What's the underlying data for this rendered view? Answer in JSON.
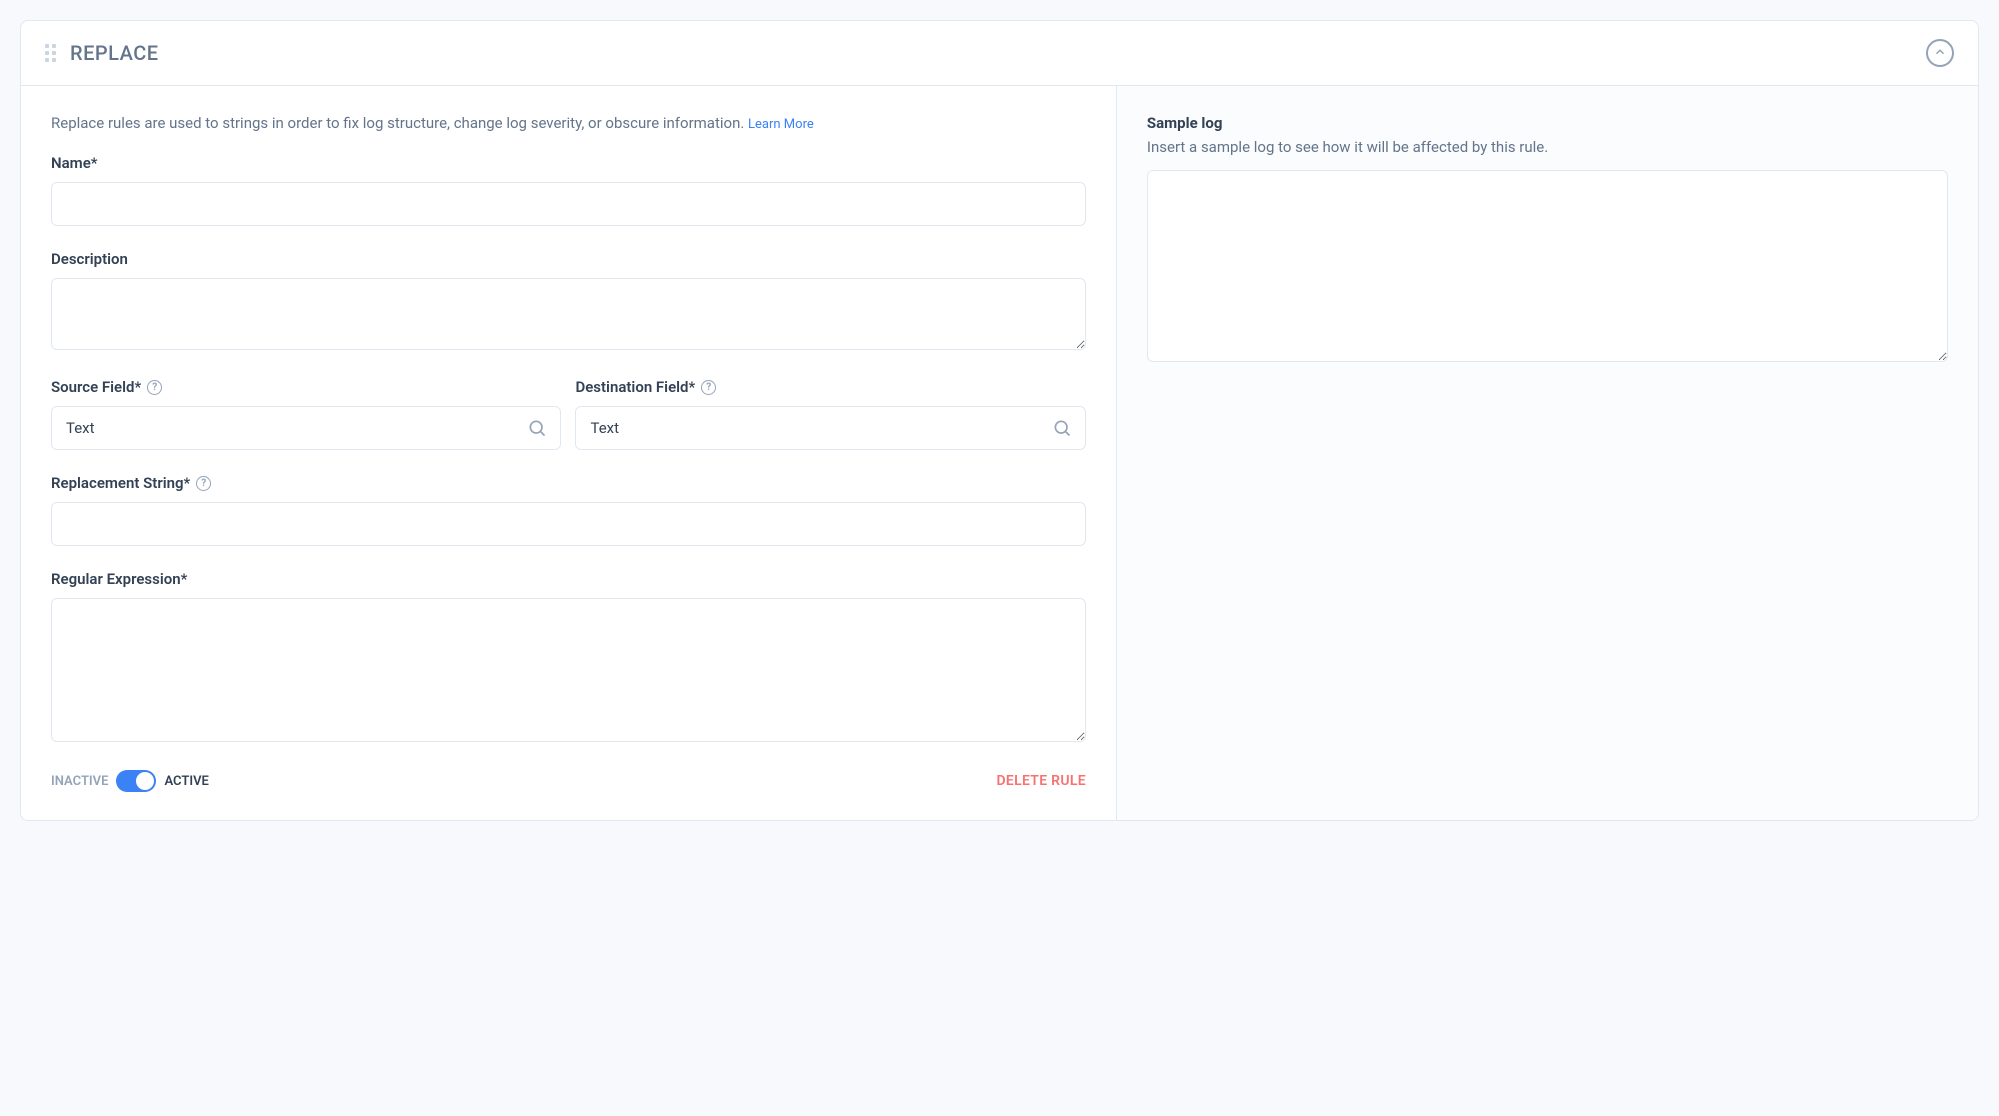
{
  "header": {
    "title": "REPLACE"
  },
  "intro": {
    "text": "Replace rules are used to strings in order to fix log structure, change log severity, or obscure information. ",
    "learn_more": "Learn More"
  },
  "form": {
    "name": {
      "label": "Name*",
      "value": ""
    },
    "description": {
      "label": "Description",
      "value": ""
    },
    "source_field": {
      "label": "Source Field*",
      "value": "Text"
    },
    "destination_field": {
      "label": "Destination Field*",
      "value": "Text"
    },
    "replacement_string": {
      "label": "Replacement String*",
      "value": ""
    },
    "regular_expression": {
      "label": "Regular Expression*",
      "value": ""
    }
  },
  "footer": {
    "inactive_label": "INACTIVE",
    "active_label": "ACTIVE",
    "delete_label": "DELETE RULE"
  },
  "sample": {
    "title": "Sample log",
    "subtitle": "Insert a sample log to see how it will be affected by this rule.",
    "value": ""
  }
}
